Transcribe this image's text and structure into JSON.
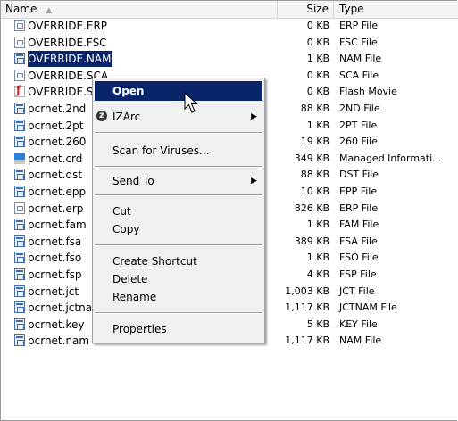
{
  "header": {
    "name": "Name",
    "size": "Size",
    "type": "Type"
  },
  "rows": [
    {
      "name": "OVERRIDE.ERP",
      "size": "0 KB",
      "type": "ERP File",
      "icon": "doc"
    },
    {
      "name": "OVERRIDE.FSC",
      "size": "0 KB",
      "type": "FSC File",
      "icon": "doc"
    },
    {
      "name": "OVERRIDE.NAM",
      "size": "1 KB",
      "type": "NAM File",
      "icon": "sys"
    },
    {
      "name": "OVERRIDE.SCA",
      "size": "0 KB",
      "type": "SCA File",
      "icon": "doc"
    },
    {
      "name": "OVERRIDE.SF",
      "size": "0 KB",
      "type": "Flash Movie",
      "icon": "flash"
    },
    {
      "name": "pcrnet.2nd",
      "size": "88 KB",
      "type": "2ND File",
      "icon": "sys"
    },
    {
      "name": "pcrnet.2pt",
      "size": "1 KB",
      "type": "2PT File",
      "icon": "sys"
    },
    {
      "name": "pcrnet.260",
      "size": "19 KB",
      "type": "260 File",
      "icon": "sys"
    },
    {
      "name": "pcrnet.crd",
      "size": "349 KB",
      "type": "Managed Informati...",
      "icon": "crd"
    },
    {
      "name": "pcrnet.dst",
      "size": "88 KB",
      "type": "DST File",
      "icon": "sys"
    },
    {
      "name": "pcrnet.epp",
      "size": "10 KB",
      "type": "EPP File",
      "icon": "sys"
    },
    {
      "name": "pcrnet.erp",
      "size": "826 KB",
      "type": "ERP File",
      "icon": "doc"
    },
    {
      "name": "pcrnet.fam",
      "size": "1 KB",
      "type": "FAM File",
      "icon": "sys"
    },
    {
      "name": "pcrnet.fsa",
      "size": "389 KB",
      "type": "FSA File",
      "icon": "sys"
    },
    {
      "name": "pcrnet.fso",
      "size": "1 KB",
      "type": "FSO File",
      "icon": "sys"
    },
    {
      "name": "pcrnet.fsp",
      "size": "4 KB",
      "type": "FSP File",
      "icon": "sys"
    },
    {
      "name": "pcrnet.jct",
      "size": "1,003 KB",
      "type": "JCT File",
      "icon": "sys"
    },
    {
      "name": "pcrnet.jctnam",
      "size": "1,117 KB",
      "type": "JCTNAM File",
      "icon": "sys"
    },
    {
      "name": "pcrnet.key",
      "size": "5 KB",
      "type": "KEY File",
      "icon": "sys"
    },
    {
      "name": "pcrnet.nam",
      "size": "1,117 KB",
      "type": "NAM File",
      "icon": "sys"
    }
  ],
  "menu": {
    "open": "Open",
    "izarc": "IZArc",
    "scan": "Scan for Viruses...",
    "send_to": "Send To",
    "cut": "Cut",
    "copy": "Copy",
    "create_shortcut": "Create Shortcut",
    "delete": "Delete",
    "rename": "Rename",
    "properties": "Properties"
  },
  "colors": {
    "selection": "#0a246a",
    "menu_bg": "#f0f0f0"
  }
}
